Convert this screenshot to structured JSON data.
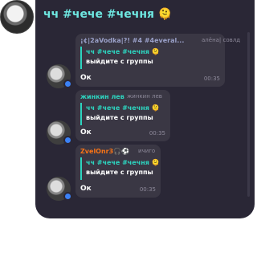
{
  "header": {
    "title": "чч #чече #чечня 🫠"
  },
  "messages": [
    {
      "sender": "¡¢|2aVodka|?! #4 #4everal...",
      "sender_color": "#9aa0c8",
      "sub": "алёна| совлд",
      "quote_title": "чч #чече #чечня 🫠",
      "quote_text": "выйдите с группы",
      "text": "Ок",
      "time": "00:35"
    },
    {
      "sender": "жинкин лев",
      "sender_color": "#2dd4bf",
      "sub": "жинкин лев",
      "quote_title": "чч #чече #чечня 🫠",
      "quote_text": "выйдите с группы",
      "text": "Ок",
      "time": "00:35"
    },
    {
      "sender": "ZvelOnr3🎧⚽",
      "sender_color": "#f97316",
      "sub": "ичиго",
      "quote_title": "чч #чече #чечня 🫠",
      "quote_text": "выйдите с группы",
      "text": "Ок",
      "time": "00:35"
    }
  ],
  "colors": {
    "panel_bg": "#2a2736",
    "bubble_bg": "#3a3744",
    "accent": "#2dd4bf",
    "title": "#6ee7e1",
    "online": "#3b82f6"
  }
}
